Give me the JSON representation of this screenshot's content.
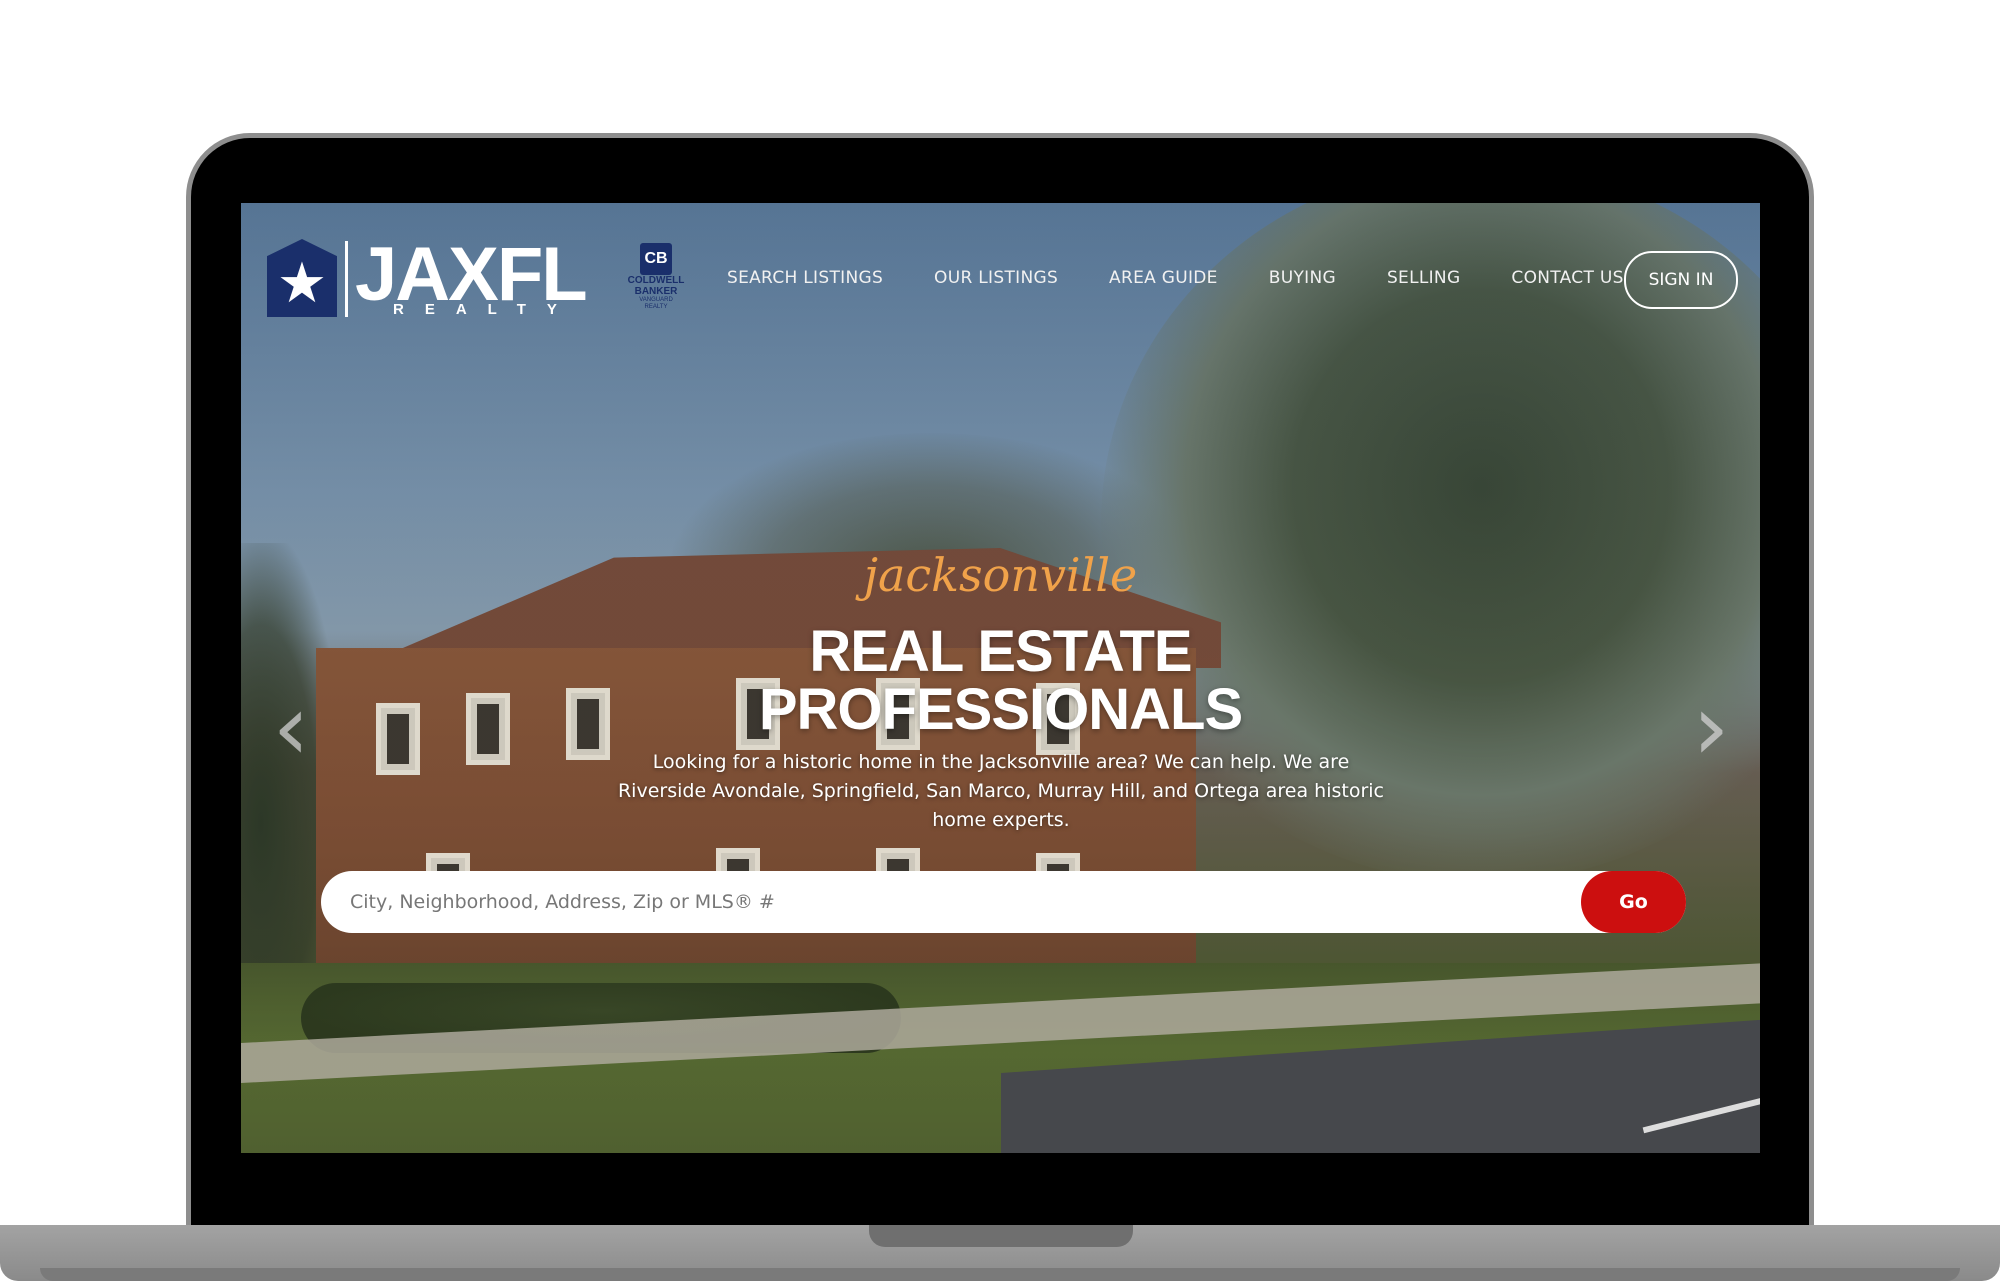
{
  "brand": {
    "name": "JAXFL",
    "sub": "REALTY",
    "partner_line1": "COLDWELL",
    "partner_line2": "BANKER",
    "partner_line3": "VANGUARD",
    "partner_line4": "REALTY",
    "partner_mark": "CB",
    "colors": {
      "navy": "#1a2f6b",
      "accent_red": "#cc0f0f",
      "tagline_orange": "#f0a24a"
    }
  },
  "nav": {
    "items": [
      {
        "label": "SEARCH LISTINGS"
      },
      {
        "label": "OUR LISTINGS"
      },
      {
        "label": "AREA GUIDE"
      },
      {
        "label": "BUYING"
      },
      {
        "label": "SELLING"
      },
      {
        "label": "CONTACT US"
      }
    ],
    "sign_in": "SIGN IN"
  },
  "hero": {
    "tagline": "jacksonville",
    "headline_line1": "REAL ESTATE",
    "headline_line2": "PROFESSIONALS",
    "description": "Looking for a historic home in the Jacksonville area? We can help. We are Riverside Avondale, Springfield, San Marco, Murray Hill, and Ortega area historic home experts."
  },
  "search": {
    "placeholder": "City, Neighborhood, Address, Zip or MLS® #",
    "value": "",
    "button": "Go"
  },
  "carousel": {
    "prev_icon": "chevron-left-icon",
    "next_icon": "chevron-right-icon"
  }
}
